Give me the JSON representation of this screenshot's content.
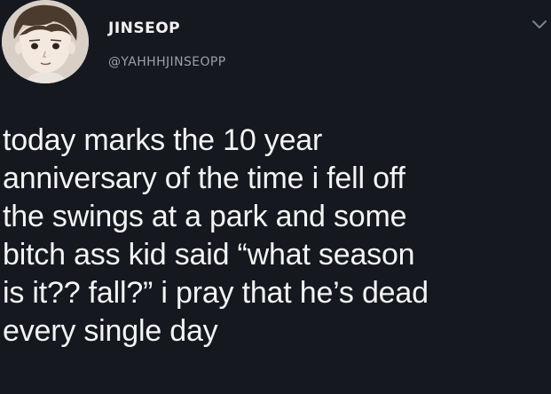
{
  "author": {
    "display_name": "JINSEOP",
    "handle": "@YAHHHJINSEOPP",
    "avatar_icon": "cartoon-boy-avatar"
  },
  "tweet": {
    "lines": [
      "today marks the 10 year",
      "anniversary of the time i fell off",
      "the swings at a park and some",
      "bitch ass kid said “what season",
      "is it?? fall?” i pray that he’s dead",
      "every single day"
    ]
  },
  "menu_icon": "chevron-down-icon",
  "colors": {
    "background": "#15181f",
    "text": "#f4f4f4",
    "muted": "#9aa1aa"
  }
}
